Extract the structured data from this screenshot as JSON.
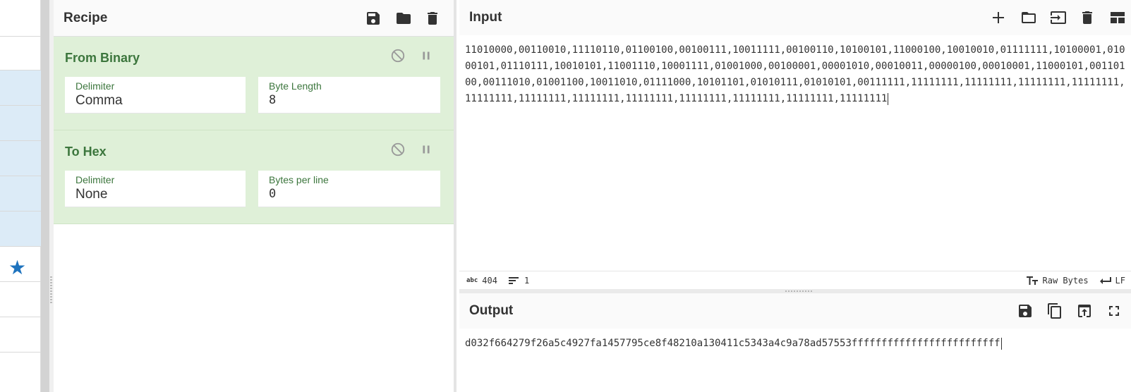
{
  "recipe": {
    "title": "Recipe",
    "operations": [
      {
        "name": "From Binary",
        "fields": [
          {
            "label": "Delimiter",
            "value": "Comma"
          },
          {
            "label": "Byte Length",
            "value": "8"
          }
        ]
      },
      {
        "name": "To Hex",
        "fields": [
          {
            "label": "Delimiter",
            "value": "None"
          },
          {
            "label": "Bytes per line",
            "value": "0"
          }
        ]
      }
    ]
  },
  "input": {
    "title": "Input",
    "text": "11010000,00110010,11110110,01100100,00100111,10011111,00100110,10100101,11000100,10010010,01111111,10100001,01000101,01110111,10010101,11001110,10001111,01001000,00100001,00001010,00010011,00000100,00010001,11000101,00110100,00111010,01001100,10011010,01111000,10101101,01010111,01010101,00111111,11111111,11111111,11111111,11111111,11111111,11111111,11111111,11111111,11111111,11111111,11111111,11111111"
  },
  "status": {
    "chars_icon": "abc",
    "chars": "404",
    "lines": "1",
    "encoding": "Raw Bytes",
    "eol": "LF"
  },
  "output": {
    "title": "Output",
    "text": "d032f664279f26a5c4927fa1457795ce8f48210a130411c5343a4c9a78ad57553fffffffffffffffffffffffff"
  },
  "colors": {
    "op_bg": "#dff0d8",
    "op_title": "#3c763d",
    "star": "#1e73be",
    "ops_selected": "#dcebf7"
  }
}
